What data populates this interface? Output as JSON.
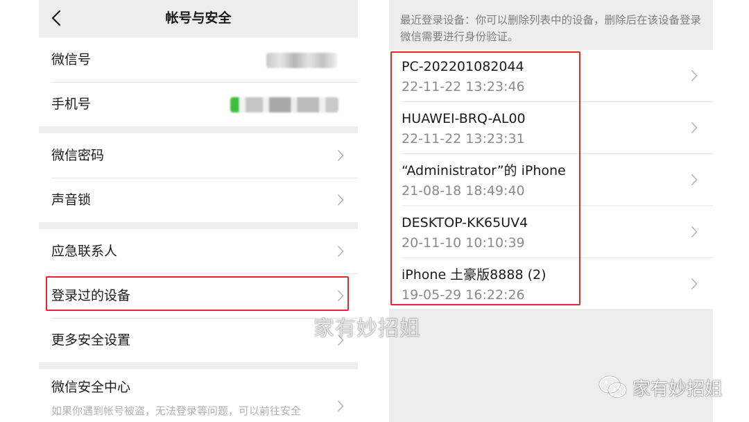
{
  "left": {
    "nav_title": "帐号与安全",
    "rows": {
      "wechat_id": "微信号",
      "phone": "手机号",
      "password": "微信密码",
      "voice_lock": "声音锁",
      "emergency": "应急联系人",
      "devices": "登录过的设备",
      "more_security": "更多安全设置",
      "security_center": "微信安全中心",
      "security_center_desc": "如果你遇到帐号被盗，无法登录等问题，可以前往安全"
    }
  },
  "right": {
    "hint": "最近登录设备：你可以删除列表中的设备，删除后在该设备登录微信需要进行身份验证。",
    "devices": [
      {
        "name": "PC-202201082044",
        "time": "22-11-22 13:23:46"
      },
      {
        "name": "HUAWEI-BRQ-AL00",
        "time": "22-11-22 13:23:31"
      },
      {
        "name": "“Administrator”的 iPhone",
        "time": "21-08-18 18:49:40"
      },
      {
        "name": "DESKTOP-KK65UV4",
        "time": "20-11-10 10:10:39"
      },
      {
        "name": "iPhone 土豪版8888 (2)",
        "time": "19-05-29 16:22:26"
      }
    ]
  },
  "watermark": {
    "center": "家有妙招姐",
    "brand": "家有妙招姐"
  },
  "colors": {
    "highlight_border": "#e02a2a",
    "page_bg": "#ededed",
    "cell_bg": "#ffffff"
  },
  "icons": [
    "chevron-left-icon",
    "chevron-right-icon",
    "wechat-logo-icon"
  ]
}
